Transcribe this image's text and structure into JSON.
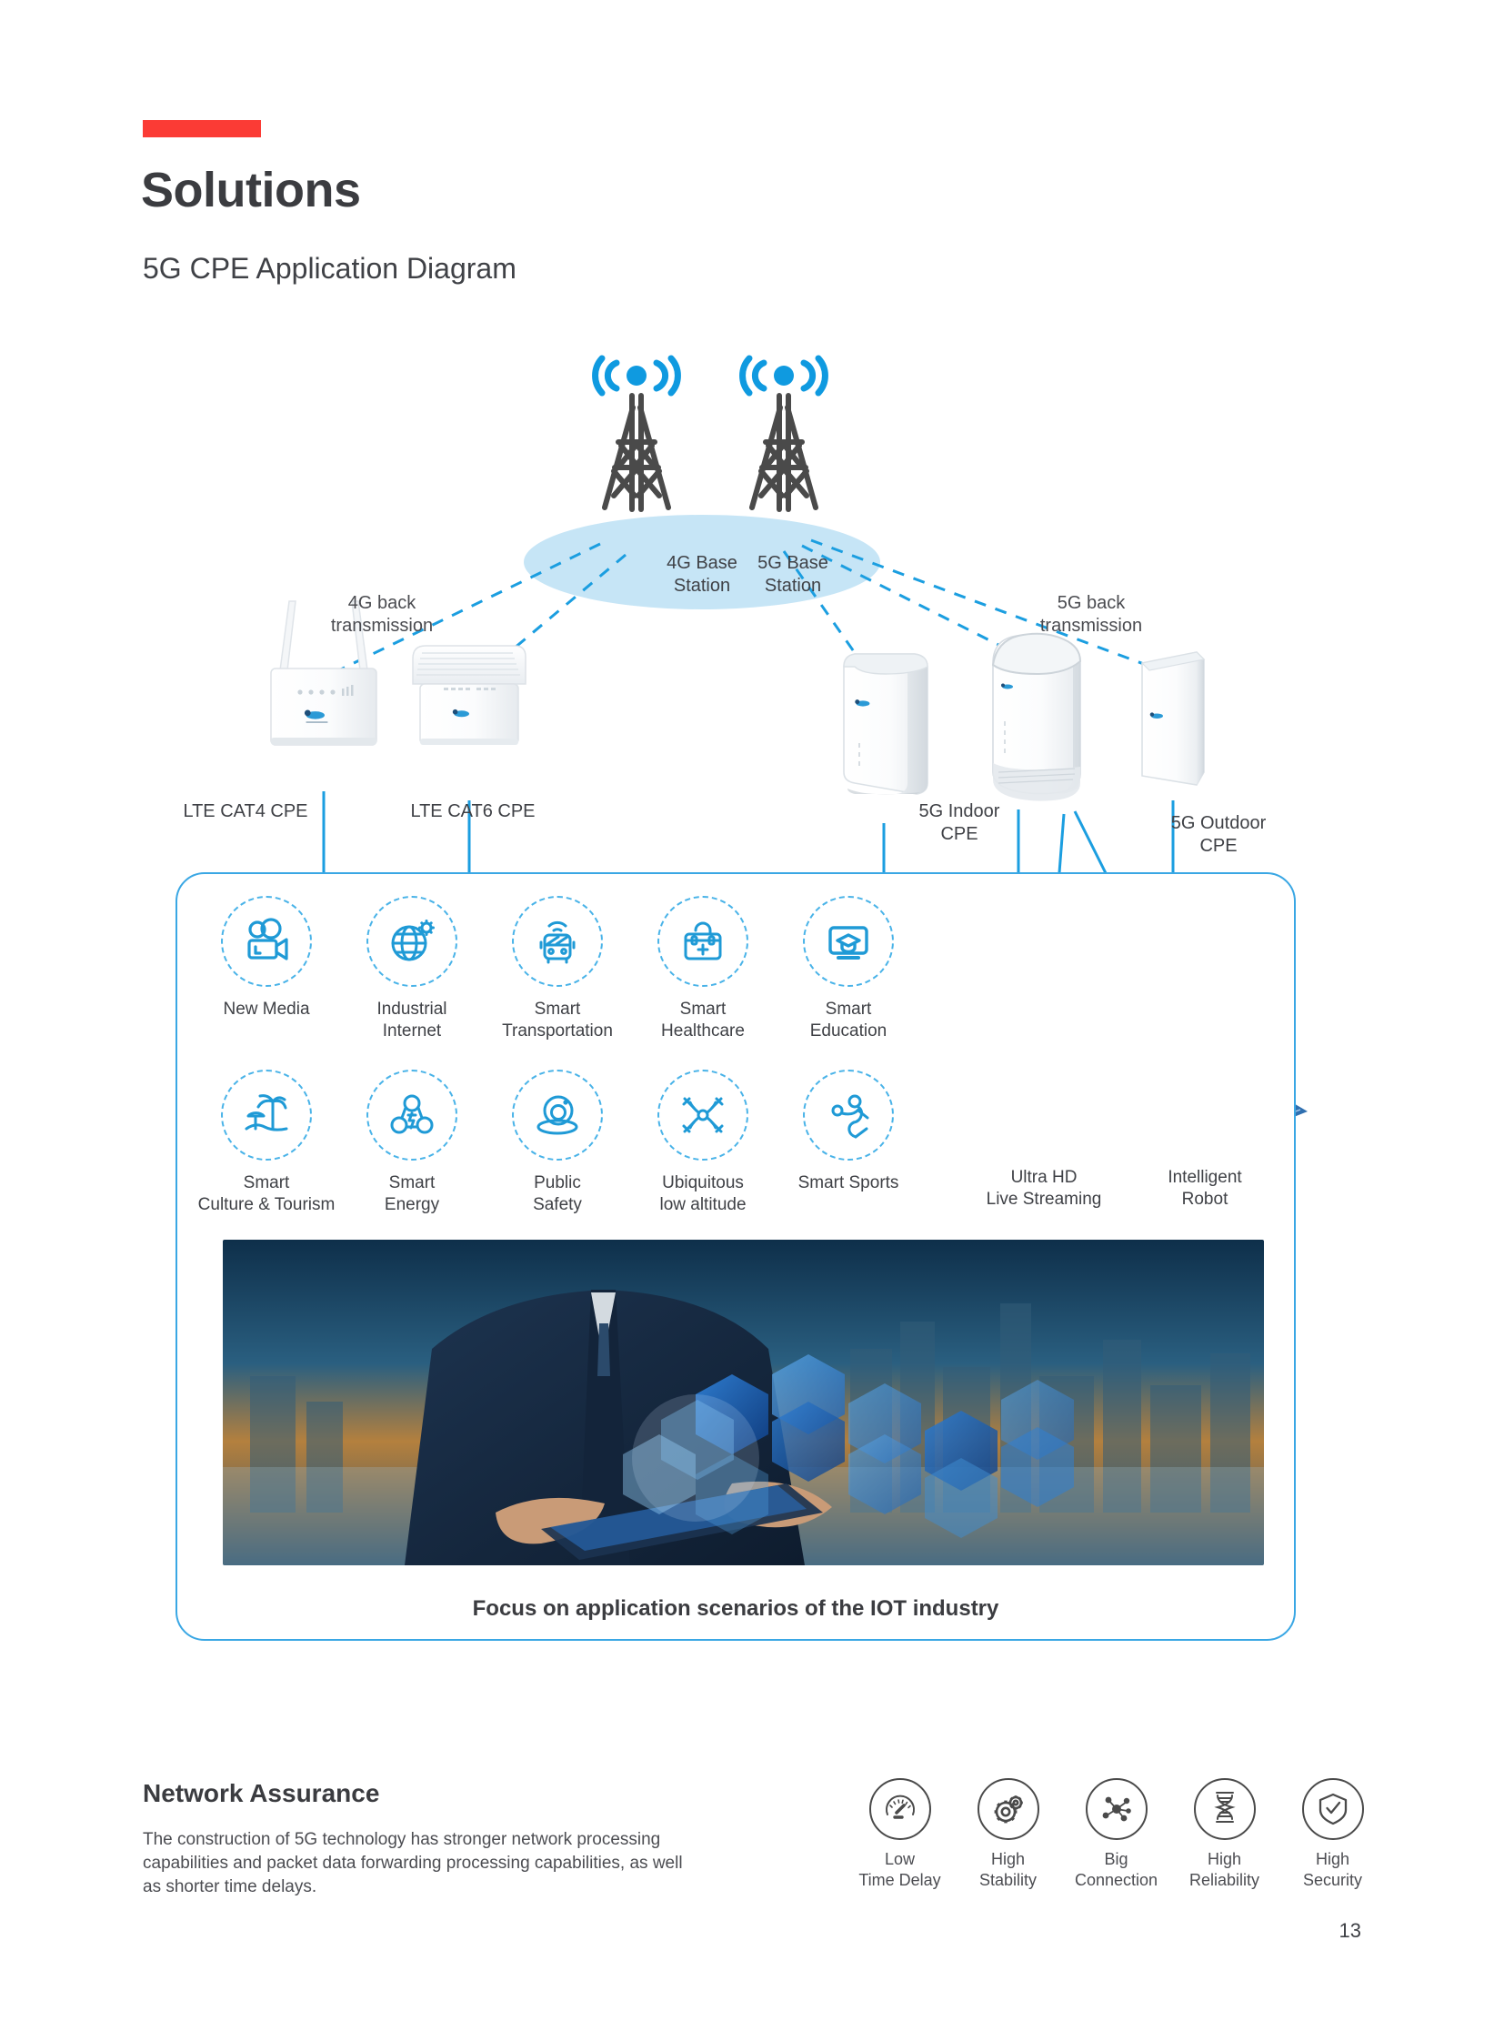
{
  "header": {
    "accent_color": "#fb3b35",
    "title": "Solutions",
    "subtitle": "5G CPE Application Diagram"
  },
  "diagram": {
    "towers": [
      {
        "name": "4g-base-station",
        "label": "4G Base\nStation"
      },
      {
        "name": "5g-base-station",
        "label": "5G Base\nStation"
      }
    ],
    "transmission_labels": [
      {
        "name": "4g-back-transmission",
        "label": "4G back\ntransmission"
      },
      {
        "name": "5g-back-transmission",
        "label": "5G back\ntransmission"
      }
    ],
    "devices": [
      {
        "name": "lte-cat4-cpe",
        "label": "LTE CAT4 CPE"
      },
      {
        "name": "lte-cat6-cpe",
        "label": "LTE CAT6 CPE"
      },
      {
        "name": "5g-indoor-cpe",
        "label": "5G Indoor\nCPE"
      },
      {
        "name": "5g-outdoor-cpe",
        "label": "5G Outdoor\nCPE"
      }
    ]
  },
  "applications": {
    "row1": [
      {
        "icon": "video-camera-icon",
        "label": "New Media"
      },
      {
        "icon": "globe-gear-icon",
        "label": "Industrial\nInternet"
      },
      {
        "icon": "bus-wifi-icon",
        "label": "Smart\nTransportation"
      },
      {
        "icon": "medical-kit-icon",
        "label": "Smart\nHealthcare"
      },
      {
        "icon": "monitor-graduation-cap-icon",
        "label": "Smart\nEducation"
      }
    ],
    "row2": [
      {
        "icon": "palm-island-icon",
        "label": "Smart\nCulture & Tourism"
      },
      {
        "icon": "energy-nodes-icon",
        "label": "Smart\nEnergy"
      },
      {
        "icon": "surveillance-camera-icon",
        "label": "Public\nSafety"
      },
      {
        "icon": "drone-icon",
        "label": "Ubiquitous\nlow altitude"
      },
      {
        "icon": "sports-person-icon",
        "label": "Smart Sports"
      }
    ],
    "side": [
      {
        "icon": "broadcast-camera-icon",
        "label": "Ultra HD\nLive Streaming"
      },
      {
        "icon": "rover-robot-icon",
        "label": "Intelligent\nRobot"
      }
    ],
    "caption": "Focus on application scenarios of the IOT industry"
  },
  "network_assurance": {
    "title": "Network Assurance",
    "body": "The construction of 5G technology has stronger network processing capabilities and packet data forwarding processing capabilities, as well as shorter time delays.",
    "features": [
      {
        "icon": "speedometer-icon",
        "label": "Low\nTime Delay"
      },
      {
        "icon": "gears-icon",
        "label": "High\nStability"
      },
      {
        "icon": "network-nodes-icon",
        "label": "Big\nConnection"
      },
      {
        "icon": "dna-helix-icon",
        "label": "High\nReliability"
      },
      {
        "icon": "shield-check-icon",
        "label": "High\nSecurity"
      }
    ]
  },
  "footer": {
    "page_number": "13"
  },
  "colors": {
    "accent_red": "#fb3b35",
    "brand_blue": "#0f9ae0",
    "light_blue": "#bfe4f5",
    "icon_blue": "#1f9ad6",
    "text_dark": "#3f4146"
  }
}
